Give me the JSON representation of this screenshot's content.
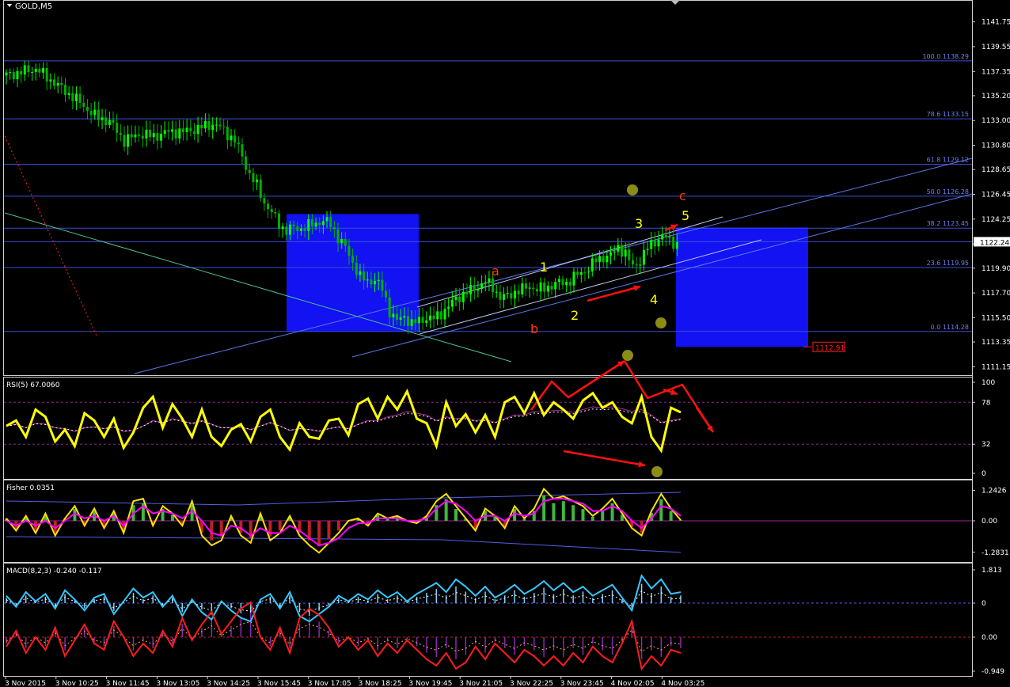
{
  "chart_data": [
    {
      "type": "line",
      "title": "GOLD,M5",
      "symbol": "GOLD",
      "timeframe": "M5",
      "price_axis": [
        "1141.75",
        "1139.55",
        "1137.35",
        "1135.20",
        "1133.00",
        "1130.80",
        "1128.65",
        "1126.45",
        "1124.25",
        "1122.05",
        "1119.90",
        "1117.70",
        "1115.50",
        "1113.35",
        "1111.15"
      ],
      "ylim": [
        1110.4,
        1142.5
      ],
      "current_price": "1122.24",
      "fibonacci_levels": [
        {
          "label": "100.0 1138.29",
          "price": 1138.29
        },
        {
          "label": "78.6 1133.15",
          "price": 1133.15
        },
        {
          "label": "61.8 1129.12",
          "price": 1129.12
        },
        {
          "label": "50.0 1126.28",
          "price": 1126.28
        },
        {
          "label": "38.2 1123.45",
          "price": 1123.45
        },
        {
          "label": "23.6 1119.95",
          "price": 1119.95
        },
        {
          "label": "0.0 1114.28",
          "price": 1114.28
        }
      ],
      "target_price": "1112.91",
      "wave_labels": [
        {
          "text": "a",
          "color": "#ff3c00"
        },
        {
          "text": "b",
          "color": "#ff3c00"
        },
        {
          "text": "c",
          "color": "#ff3c00"
        },
        {
          "text": "1",
          "color": "#ffff00"
        },
        {
          "text": "2",
          "color": "#ffff00"
        },
        {
          "text": "3",
          "color": "#ffff00"
        },
        {
          "text": "4",
          "color": "#ffff00"
        },
        {
          "text": "5",
          "color": "#ffff00"
        }
      ],
      "x_tick_labels": [
        "3 Nov 2015",
        "3 Nov 10:25",
        "3 Nov 11:45",
        "3 Nov 13:05",
        "3 Nov 14:25",
        "3 Nov 15:45",
        "3 Nov 17:05",
        "3 Nov 18:25",
        "3 Nov 19:45",
        "3 Nov 21:05",
        "3 Nov 22:25",
        "3 Nov 23:45",
        "4 Nov 02:05",
        "4 Nov 03:25"
      ],
      "price_path": [
        [
          0,
          1137.0
        ],
        [
          4,
          1137.3
        ],
        [
          8,
          1137.6
        ],
        [
          12,
          1136.6
        ],
        [
          16,
          1135.6
        ],
        [
          20,
          1134.6
        ],
        [
          24,
          1133.4
        ],
        [
          28,
          1132.9
        ],
        [
          32,
          1131.2
        ],
        [
          36,
          1131.8
        ],
        [
          40,
          1131.6
        ],
        [
          44,
          1132.0
        ],
        [
          48,
          1132.0
        ],
        [
          52,
          1132.3
        ],
        [
          56,
          1132.7
        ],
        [
          58,
          1132.4
        ],
        [
          62,
          1131.2
        ],
        [
          64,
          1129.8
        ],
        [
          66,
          1128.2
        ],
        [
          68,
          1127.2
        ],
        [
          70,
          1125.7
        ],
        [
          72,
          1124.8
        ],
        [
          74,
          1123.8
        ],
        [
          76,
          1123.2
        ],
        [
          78,
          1123.5
        ],
        [
          80,
          1123.4
        ],
        [
          84,
          1123.9
        ],
        [
          86,
          1124.1
        ],
        [
          88,
          1123.8
        ],
        [
          90,
          1122.6
        ],
        [
          92,
          1121.7
        ],
        [
          94,
          1120.4
        ],
        [
          96,
          1119.1
        ],
        [
          98,
          1118.7
        ],
        [
          100,
          1118.9
        ],
        [
          102,
          1118.0
        ],
        [
          104,
          1116.1
        ],
        [
          106,
          1115.2
        ],
        [
          108,
          1115.6
        ],
        [
          110,
          1115.0
        ],
        [
          112,
          1115.2
        ],
        [
          114,
          1115.5
        ],
        [
          116,
          1115.4
        ],
        [
          118,
          1115.9
        ],
        [
          120,
          1116.5
        ],
        [
          122,
          1117.2
        ],
        [
          124,
          1117.6
        ],
        [
          126,
          1117.9
        ],
        [
          128,
          1118.3
        ],
        [
          130,
          1118.7
        ],
        [
          132,
          1118.2
        ],
        [
          134,
          1117.3
        ],
        [
          136,
          1117.4
        ],
        [
          138,
          1117.8
        ],
        [
          140,
          1118.0
        ],
        [
          142,
          1118.3
        ],
        [
          144,
          1118.0
        ],
        [
          146,
          1118.1
        ],
        [
          148,
          1118.4
        ],
        [
          150,
          1118.6
        ],
        [
          152,
          1118.6
        ],
        [
          154,
          1119.1
        ],
        [
          156,
          1119.5
        ],
        [
          158,
          1119.9
        ],
        [
          160,
          1120.6
        ],
        [
          162,
          1120.9
        ],
        [
          164,
          1121.0
        ],
        [
          166,
          1121.8
        ],
        [
          168,
          1121.2
        ],
        [
          170,
          1120.0
        ],
        [
          172,
          1120.6
        ],
        [
          174,
          1121.7
        ],
        [
          176,
          1122.3
        ],
        [
          178,
          1122.7
        ],
        [
          180,
          1122.4
        ],
        [
          182,
          1122.0
        ],
        [
          183,
          1122.2
        ]
      ]
    },
    {
      "type": "line",
      "title": "RSI(5) 67.0060",
      "y_axis": [
        "100",
        "78",
        "32",
        "0"
      ],
      "ylim": [
        0,
        100
      ],
      "series": [
        {
          "values": [
            52,
            58,
            40,
            70,
            62,
            35,
            48,
            30,
            66,
            58,
            40,
            60,
            28,
            45,
            72,
            84,
            50,
            76,
            60,
            40,
            70,
            40,
            30,
            48,
            54,
            35,
            62,
            70,
            40,
            26,
            55,
            40,
            38,
            58,
            60,
            42,
            76,
            82,
            60,
            84,
            70,
            90,
            60,
            55,
            30,
            78,
            52,
            65,
            45,
            64,
            40,
            78,
            84,
            66,
            88,
            64,
            78,
            70,
            60,
            80,
            88,
            72,
            78,
            62,
            55,
            84,
            40,
            25,
            72,
            67
          ]
        },
        {
          "values": [
            52,
            54,
            50,
            55,
            54,
            50,
            49,
            46,
            50,
            51,
            49,
            51,
            46,
            47,
            52,
            58,
            56,
            60,
            58,
            55,
            58,
            54,
            50,
            50,
            51,
            48,
            52,
            56,
            52,
            47,
            49,
            48,
            46,
            49,
            51,
            49,
            54,
            58,
            58,
            62,
            64,
            68,
            66,
            64,
            58,
            62,
            60,
            61,
            58,
            59,
            56,
            60,
            64,
            64,
            68,
            67,
            69,
            69,
            67,
            70,
            73,
            72,
            73,
            71,
            68,
            70,
            64,
            56,
            58,
            60
          ]
        }
      ]
    },
    {
      "type": "line",
      "title": "Fisher 0.0351",
      "y_axis": [
        "1.2426",
        "0.00",
        "-1.2831"
      ],
      "ylim": [
        -1.45,
        1.42
      ],
      "series": [
        {
          "values": [
            0.1,
            -0.4,
            0.2,
            -0.5,
            0.3,
            -0.6,
            0.1,
            0.6,
            -0.2,
            0.5,
            -0.3,
            0.4,
            -0.5,
            0.8,
            0.9,
            -0.2,
            0.6,
            0.3,
            -0.2,
            0.8,
            -0.6,
            -1.0,
            -0.8,
            0.2,
            -0.6,
            -0.9,
            0.3,
            -0.8,
            -0.5,
            0.2,
            -0.6,
            -1.0,
            -1.3,
            -0.9,
            -0.5,
            0.0,
            0.1,
            -0.2,
            0.3,
            0.1,
            0.2,
            0.0,
            -0.1,
            0.2,
            0.8,
            1.1,
            0.6,
            0.1,
            -0.4,
            0.5,
            0.2,
            -0.3,
            0.6,
            0.1,
            0.5,
            1.3,
            0.9,
            1.0,
            0.8,
            0.6,
            0.2,
            0.5,
            0.9,
            0.3,
            -0.3,
            -0.6,
            0.4,
            1.1,
            0.5,
            0.03
          ]
        },
        {
          "values": [
            0.0,
            -0.2,
            0.0,
            -0.2,
            0.0,
            -0.3,
            0.0,
            0.3,
            0.1,
            0.2,
            0.0,
            0.2,
            -0.2,
            0.3,
            0.6,
            0.3,
            0.4,
            0.3,
            0.1,
            0.4,
            0.0,
            -0.5,
            -0.6,
            -0.2,
            -0.3,
            -0.6,
            -0.3,
            -0.5,
            -0.5,
            -0.2,
            -0.4,
            -0.7,
            -1.0,
            -0.9,
            -0.7,
            -0.3,
            -0.1,
            -0.1,
            0.1,
            0.1,
            0.1,
            0.0,
            0.0,
            0.1,
            0.5,
            0.8,
            0.7,
            0.4,
            0.0,
            0.2,
            0.2,
            0.0,
            0.3,
            0.2,
            0.3,
            0.8,
            0.9,
            0.9,
            0.8,
            0.7,
            0.4,
            0.4,
            0.6,
            0.4,
            0.0,
            -0.3,
            0.1,
            0.6,
            0.5,
            0.2
          ]
        }
      ]
    },
    {
      "type": "line",
      "title": "MACD(8,2,3) -0.240 -0.117",
      "y_axis": [
        "1.813",
        "0",
        "0.00",
        "-0.949"
      ],
      "series": [
        {
          "values": [
            0.4,
            -0.2,
            0.6,
            0.1,
            0.5,
            -0.3,
            0.7,
            0.2,
            -0.4,
            0.3,
            0.5,
            -0.6,
            0.1,
            0.8,
            0.3,
            0.6,
            -0.2,
            0.4,
            -0.7,
            0.2,
            -0.5,
            -0.9,
            0.1,
            -0.4,
            -0.8,
            -1.0,
            0.2,
            0.5,
            -0.3,
            0.6,
            -0.7,
            -1.0,
            -0.6,
            -0.2,
            0.4,
            0.1,
            0.5,
            0.2,
            0.7,
            0.3,
            0.6,
            0.1,
            0.5,
            0.8,
            1.1,
            0.6,
            1.3,
            0.9,
            0.4,
            0.9,
            0.3,
            0.6,
            1.0,
            0.5,
            0.8,
            1.2,
            0.7,
            1.1,
            0.6,
            0.9,
            0.4,
            0.7,
            1.0,
            0.3,
            -0.4,
            1.5,
            0.8,
            1.3,
            0.5,
            0.6
          ]
        },
        {
          "values": [
            -0.3,
            0.2,
            -0.5,
            0.0,
            -0.4,
            0.3,
            -0.6,
            -0.1,
            0.4,
            -0.2,
            -0.4,
            0.5,
            0.0,
            -0.6,
            -0.2,
            -0.5,
            0.2,
            -0.3,
            0.6,
            -0.1,
            0.4,
            0.8,
            0.1,
            0.5,
            0.9,
            1.1,
            0.0,
            -0.4,
            0.3,
            -0.5,
            0.6,
            0.9,
            0.7,
            0.3,
            -0.3,
            0.0,
            -0.4,
            -0.1,
            -0.6,
            -0.2,
            -0.5,
            -0.1,
            -0.4,
            -0.7,
            -0.9,
            -0.5,
            -1.0,
            -0.8,
            -0.3,
            -0.7,
            -0.2,
            -0.5,
            -0.8,
            -0.4,
            -0.6,
            -0.9,
            -0.6,
            -0.9,
            -0.5,
            -0.8,
            -0.3,
            -0.6,
            -0.8,
            -0.2,
            0.5,
            -1.0,
            -0.6,
            -0.9,
            -0.4,
            -0.5
          ]
        }
      ]
    }
  ],
  "colors": {
    "background": "#000000",
    "grid": "#3d4a66",
    "fib_line": "#3a4fd8",
    "fib_label": "#6f7ff2",
    "price_up": "#00ff00",
    "price_down": "#00b000",
    "box": "#1212f2",
    "rsi": "#ffff00",
    "rsi_signal": "#b02aa0",
    "fisher_main": "#ffe000",
    "fisher_signal": "#ff00ff",
    "macd_main": "#35c7ff",
    "macd_signal": "#ff1c1c",
    "annotation_red": "#ff1010",
    "marker_olive": "#8c8c14",
    "axis_text": "#ffffff",
    "current_price_bg": "#ffffff",
    "target_label": "#ff1a1a"
  },
  "icons": {
    "menu": "triangle-down-icon",
    "scroll": "scroll-marker-icon"
  }
}
